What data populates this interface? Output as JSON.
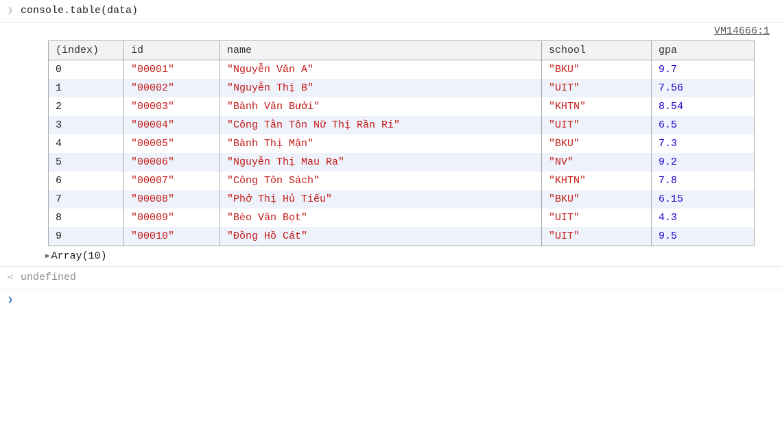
{
  "input_line": "console.table(data)",
  "source_link": "VM14666:1",
  "headers": {
    "index": "(index)",
    "id": "id",
    "name": "name",
    "school": "school",
    "gpa": "gpa"
  },
  "rows": [
    {
      "index": "0",
      "id": "\"00001\"",
      "name": "\"Nguyễn Văn A\"",
      "school": "\"BKU\"",
      "gpa": "9.7"
    },
    {
      "index": "1",
      "id": "\"00002\"",
      "name": "\"Nguyễn Thị B\"",
      "school": "\"UIT\"",
      "gpa": "7.56"
    },
    {
      "index": "2",
      "id": "\"00003\"",
      "name": "\"Bành Văn Bưởi\"",
      "school": "\"KHTN\"",
      "gpa": "8.54"
    },
    {
      "index": "3",
      "id": "\"00004\"",
      "name": "\"Công Tằn Tôn Nữ Thị Rần Ri\"",
      "school": "\"UIT\"",
      "gpa": "6.5"
    },
    {
      "index": "4",
      "id": "\"00005\"",
      "name": "\"Bành Thị Mận\"",
      "school": "\"BKU\"",
      "gpa": "7.3"
    },
    {
      "index": "5",
      "id": "\"00006\"",
      "name": "\"Nguyễn Thị Mau Ra\"",
      "school": "\"NV\"",
      "gpa": "9.2"
    },
    {
      "index": "6",
      "id": "\"00007\"",
      "name": "\"Công Tôn Sách\"",
      "school": "\"KHTN\"",
      "gpa": "7.8"
    },
    {
      "index": "7",
      "id": "\"00008\"",
      "name": "\"Phở Thị Hủ Tiếu\"",
      "school": "\"BKU\"",
      "gpa": "6.15"
    },
    {
      "index": "8",
      "id": "\"00009\"",
      "name": "\"Bèo Văn Bọt\"",
      "school": "\"UIT\"",
      "gpa": "4.3"
    },
    {
      "index": "9",
      "id": "\"00010\"",
      "name": "\"Đồng Hồ Cát\"",
      "school": "\"UIT\"",
      "gpa": "9.5"
    }
  ],
  "expander_label": "Array(10)",
  "return_value": "undefined",
  "chart_data": {
    "type": "table",
    "title": "console.table(data)",
    "columns": [
      "(index)",
      "id",
      "name",
      "school",
      "gpa"
    ],
    "data": [
      [
        0,
        "00001",
        "Nguyễn Văn A",
        "BKU",
        9.7
      ],
      [
        1,
        "00002",
        "Nguyễn Thị B",
        "UIT",
        7.56
      ],
      [
        2,
        "00003",
        "Bành Văn Bưởi",
        "KHTN",
        8.54
      ],
      [
        3,
        "00004",
        "Công Tằn Tôn Nữ Thị Rần Ri",
        "UIT",
        6.5
      ],
      [
        4,
        "00005",
        "Bành Thị Mận",
        "BKU",
        7.3
      ],
      [
        5,
        "00006",
        "Nguyễn Thị Mau Ra",
        "NV",
        9.2
      ],
      [
        6,
        "00007",
        "Công Tôn Sách",
        "KHTN",
        7.8
      ],
      [
        7,
        "00008",
        "Phở Thị Hủ Tiếu",
        "BKU",
        6.15
      ],
      [
        8,
        "00009",
        "Bèo Văn Bọt",
        "UIT",
        4.3
      ],
      [
        9,
        "00010",
        "Đồng Hồ Cát",
        "UIT",
        9.5
      ]
    ]
  }
}
